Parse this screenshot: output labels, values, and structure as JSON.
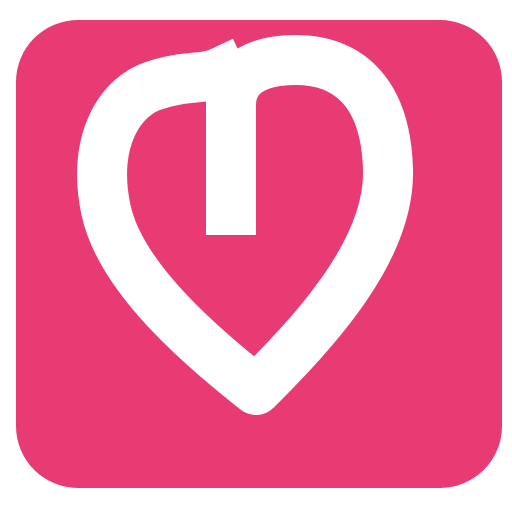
{
  "icon": {
    "name": "heart-app-icon",
    "background_color": "#E83A73",
    "foreground_color": "#FFFFFF"
  }
}
